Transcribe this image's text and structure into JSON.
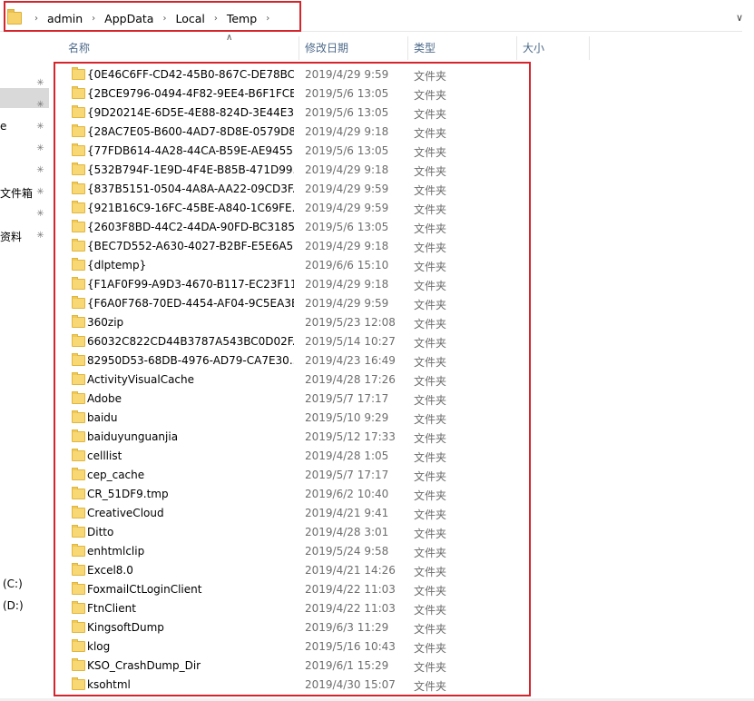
{
  "address": {
    "crumbs": [
      "admin",
      "AppData",
      "Local",
      "Temp"
    ]
  },
  "sidebar": {
    "labels": [
      {
        "text": "e",
        "pinned": true
      },
      {
        "text": "文件箱",
        "pinned": true
      },
      {
        "text": "资料",
        "pinned": true
      },
      {
        "text": "(C:)",
        "pinned": false
      },
      {
        "text": "(D:)",
        "pinned": false
      }
    ]
  },
  "columns": {
    "name": "名称",
    "date": "修改日期",
    "type": "类型",
    "size": "大小"
  },
  "files": [
    {
      "name": "{0E46C6FF-CD42-45B0-867C-DE78BC...",
      "date": "2019/4/29 9:59",
      "type": "文件夹"
    },
    {
      "name": "{2BCE9796-0494-4F82-9EE4-B6F1FCE...",
      "date": "2019/5/6 13:05",
      "type": "文件夹"
    },
    {
      "name": "{9D20214E-6D5E-4E88-824D-3E44E3...",
      "date": "2019/5/6 13:05",
      "type": "文件夹"
    },
    {
      "name": "{28AC7E05-B600-4AD7-8D8E-0579D8...",
      "date": "2019/4/29 9:18",
      "type": "文件夹"
    },
    {
      "name": "{77FDB614-4A28-44CA-B59E-AE9455...",
      "date": "2019/5/6 13:05",
      "type": "文件夹"
    },
    {
      "name": "{532B794F-1E9D-4F4E-B85B-471D99...",
      "date": "2019/4/29 9:18",
      "type": "文件夹"
    },
    {
      "name": "{837B5151-0504-4A8A-AA22-09CD3F...",
      "date": "2019/4/29 9:59",
      "type": "文件夹"
    },
    {
      "name": "{921B16C9-16FC-45BE-A840-1C69FE...",
      "date": "2019/4/29 9:59",
      "type": "文件夹"
    },
    {
      "name": "{2603F8BD-44C2-44DA-90FD-BC3185...",
      "date": "2019/5/6 13:05",
      "type": "文件夹"
    },
    {
      "name": "{BEC7D552-A630-4027-B2BF-E5E6A5...",
      "date": "2019/4/29 9:18",
      "type": "文件夹"
    },
    {
      "name": "{dlptemp}",
      "date": "2019/6/6 15:10",
      "type": "文件夹"
    },
    {
      "name": "{F1AF0F99-A9D3-4670-B117-EC23F11...",
      "date": "2019/4/29 9:18",
      "type": "文件夹"
    },
    {
      "name": "{F6A0F768-70ED-4454-AF04-9C5EA3E...",
      "date": "2019/4/29 9:59",
      "type": "文件夹"
    },
    {
      "name": "360zip",
      "date": "2019/5/23 12:08",
      "type": "文件夹"
    },
    {
      "name": "66032C822CD44B3787A543BC0D02F...",
      "date": "2019/5/14 10:27",
      "type": "文件夹"
    },
    {
      "name": "82950D53-68DB-4976-AD79-CA7E30...",
      "date": "2019/4/23 16:49",
      "type": "文件夹"
    },
    {
      "name": "ActivityVisualCache",
      "date": "2019/4/28 17:26",
      "type": "文件夹"
    },
    {
      "name": "Adobe",
      "date": "2019/5/7 17:17",
      "type": "文件夹"
    },
    {
      "name": "baidu",
      "date": "2019/5/10 9:29",
      "type": "文件夹"
    },
    {
      "name": "baiduyunguanjia",
      "date": "2019/5/12 17:33",
      "type": "文件夹"
    },
    {
      "name": "celllist",
      "date": "2019/4/28 1:05",
      "type": "文件夹"
    },
    {
      "name": "cep_cache",
      "date": "2019/5/7 17:17",
      "type": "文件夹"
    },
    {
      "name": "CR_51DF9.tmp",
      "date": "2019/6/2 10:40",
      "type": "文件夹"
    },
    {
      "name": "CreativeCloud",
      "date": "2019/4/21 9:41",
      "type": "文件夹"
    },
    {
      "name": "Ditto",
      "date": "2019/4/28 3:01",
      "type": "文件夹"
    },
    {
      "name": "enhtmlclip",
      "date": "2019/5/24 9:58",
      "type": "文件夹"
    },
    {
      "name": "Excel8.0",
      "date": "2019/4/21 14:26",
      "type": "文件夹"
    },
    {
      "name": "FoxmailCtLoginClient",
      "date": "2019/4/22 11:03",
      "type": "文件夹"
    },
    {
      "name": "FtnClient",
      "date": "2019/4/22 11:03",
      "type": "文件夹"
    },
    {
      "name": "KingsoftDump",
      "date": "2019/6/3 11:29",
      "type": "文件夹"
    },
    {
      "name": "klog",
      "date": "2019/5/16 10:43",
      "type": "文件夹"
    },
    {
      "name": "KSO_CrashDump_Dir",
      "date": "2019/6/1 15:29",
      "type": "文件夹"
    },
    {
      "name": "ksohtml",
      "date": "2019/4/30 15:07",
      "type": "文件夹"
    }
  ]
}
